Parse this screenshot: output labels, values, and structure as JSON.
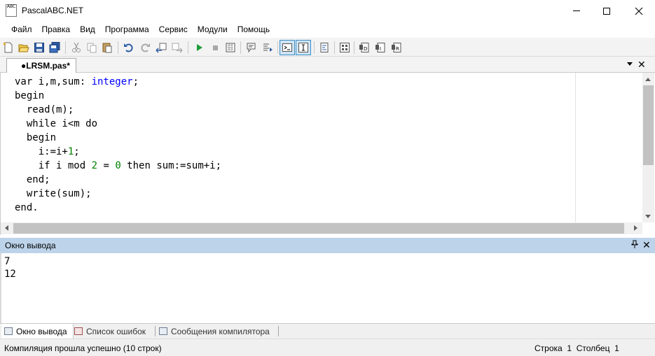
{
  "window": {
    "title": "PascalABC.NET",
    "icon_text": "ABC"
  },
  "menu": [
    "Файл",
    "Правка",
    "Вид",
    "Программа",
    "Сервис",
    "Модули",
    "Помощь"
  ],
  "toolbar_icons": [
    "new-file-icon",
    "open-folder-icon",
    "save-icon",
    "save-all-icon",
    "cut-icon",
    "copy-icon",
    "paste-icon",
    "undo-icon",
    "redo-icon",
    "back-icon",
    "forward-icon",
    "run-icon",
    "stop-icon",
    "compile-icon",
    "comment-icon",
    "uncomment-icon",
    "console-output-icon",
    "text-input-icon",
    "format-icon",
    "settings-icon",
    "debug-step-into-icon",
    "debug-step-over-icon",
    "debug-run-to-cursor-icon"
  ],
  "editor": {
    "tab_label": "●LRSM.pas*",
    "code_lines": [
      [
        {
          "t": "var i,m,sum: ",
          "c": "kw"
        },
        {
          "t": "integer",
          "c": "ty"
        },
        {
          "t": ";",
          "c": "kw"
        }
      ],
      [
        {
          "t": "begin",
          "c": "kw"
        }
      ],
      [
        {
          "t": "  read(m);",
          "c": "kw"
        }
      ],
      [
        {
          "t": "  while i<m do",
          "c": "kw"
        }
      ],
      [
        {
          "t": "  begin",
          "c": "kw"
        }
      ],
      [
        {
          "t": "    i:=i+",
          "c": "kw"
        },
        {
          "t": "1",
          "c": "nm"
        },
        {
          "t": ";",
          "c": "kw"
        }
      ],
      [
        {
          "t": "    if i mod ",
          "c": "kw"
        },
        {
          "t": "2",
          "c": "nm"
        },
        {
          "t": " = ",
          "c": "kw"
        },
        {
          "t": "0",
          "c": "nm"
        },
        {
          "t": " then sum:=sum+i;",
          "c": "kw"
        }
      ],
      [
        {
          "t": "  end;",
          "c": "kw"
        }
      ],
      [
        {
          "t": "  write(sum);",
          "c": "kw"
        }
      ],
      [
        {
          "t": "end.",
          "c": "kw"
        }
      ]
    ]
  },
  "output": {
    "title": "Окно вывода",
    "lines": [
      "7",
      "12"
    ]
  },
  "bottom_tabs": [
    "Окно вывода",
    "Список ошибок",
    "Сообщения компилятора"
  ],
  "status": {
    "message": "Компиляция прошла успешно (10 строк)",
    "row_label": "Строка",
    "row_value": "1",
    "col_label": "Столбец",
    "col_value": "1"
  }
}
